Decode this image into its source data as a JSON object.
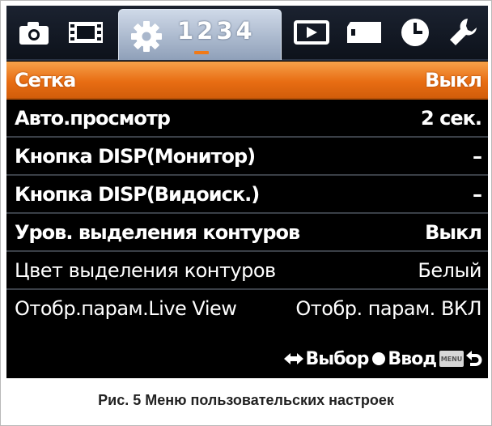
{
  "tabs": {
    "icons": [
      "camera-icon",
      "movie-icon",
      "setup-gear-icon",
      "playback-icon",
      "memory-card-icon",
      "clock-icon",
      "wrench-icon"
    ],
    "setup_pages": "1234",
    "active_page": 2,
    "accent_color": "#f07a18"
  },
  "menu": {
    "items": [
      {
        "label": "Сетка",
        "value": "Выкл"
      },
      {
        "label": "Авто.просмотр",
        "value": "2 сек."
      },
      {
        "label": "Кнопка DISP(Монитор)",
        "value": "–"
      },
      {
        "label": "Кнопка DISP(Видоиск.)",
        "value": "–"
      },
      {
        "label": "Уров. выделения контуров",
        "value": "Выкл"
      },
      {
        "label": "Цвет выделения контуров",
        "value": "Белый"
      },
      {
        "label": "Отобр.парам.Live View",
        "value": "Отобр. парам. ВКЛ"
      }
    ],
    "selected_index": 0,
    "highlight_color": "#e86d13"
  },
  "hints": {
    "select_label": "Выбор",
    "enter_label": "Ввод",
    "menu_key": "MENU"
  },
  "caption": "Рис. 5 Меню пользовательских настроек"
}
